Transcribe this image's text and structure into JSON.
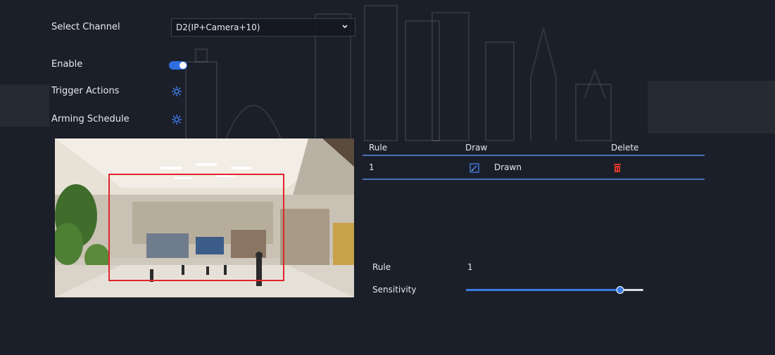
{
  "form": {
    "select_channel_label": "Select Channel",
    "channel_value": "D2(IP+Camera+10)",
    "enable_label": "Enable",
    "enable_on": true,
    "trigger_actions_label": "Trigger Actions",
    "arming_schedule_label": "Arming Schedule"
  },
  "table": {
    "headers": {
      "rule": "Rule",
      "draw": "Draw",
      "delete": "Delete"
    },
    "rows": [
      {
        "rule": "1",
        "draw_status": "Drawn"
      }
    ]
  },
  "settings": {
    "rule_label": "Rule",
    "rule_value": "1",
    "sensitivity_label": "Sensitivity",
    "sensitivity_fraction": 0.87
  },
  "colors": {
    "accent": "#3c7be6",
    "toggle": "#2f6ee0",
    "delete": "#e0352b",
    "detection_box": "#e0252b",
    "table_line": "#4a6fb8"
  },
  "icons": {
    "trigger_actions": "gear-icon",
    "arming_schedule": "gear-icon",
    "draw": "edit-icon",
    "delete": "trash-icon",
    "channel_dropdown": "chevron-down-icon"
  }
}
